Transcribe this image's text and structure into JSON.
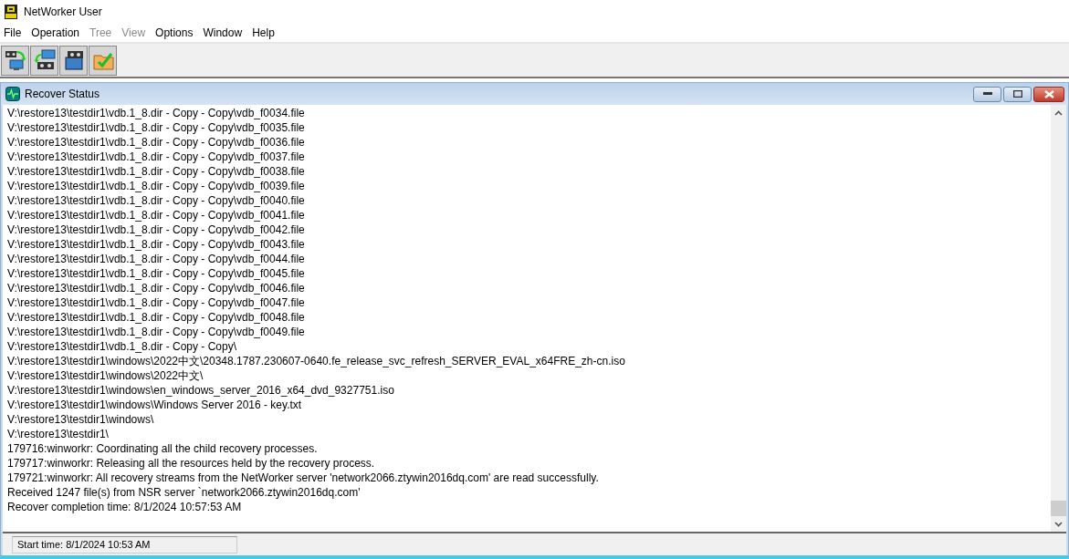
{
  "window": {
    "title": "NetWorker User"
  },
  "menu": [
    {
      "label": "File",
      "disabled": false
    },
    {
      "label": "Operation",
      "disabled": false
    },
    {
      "label": "Tree",
      "disabled": true
    },
    {
      "label": "View",
      "disabled": true
    },
    {
      "label": "Options",
      "disabled": false
    },
    {
      "label": "Window",
      "disabled": false
    },
    {
      "label": "Help",
      "disabled": false
    }
  ],
  "toolbar": [
    {
      "kind": "recover"
    },
    {
      "kind": "backup"
    },
    {
      "kind": "archive"
    },
    {
      "kind": "verify"
    }
  ],
  "child_window": {
    "title": "Recover Status"
  },
  "log_lines": [
    "V:\\restore13\\testdir1\\vdb.1_8.dir - Copy - Copy\\vdb_f0034.file",
    "V:\\restore13\\testdir1\\vdb.1_8.dir - Copy - Copy\\vdb_f0035.file",
    "V:\\restore13\\testdir1\\vdb.1_8.dir - Copy - Copy\\vdb_f0036.file",
    "V:\\restore13\\testdir1\\vdb.1_8.dir - Copy - Copy\\vdb_f0037.file",
    "V:\\restore13\\testdir1\\vdb.1_8.dir - Copy - Copy\\vdb_f0038.file",
    "V:\\restore13\\testdir1\\vdb.1_8.dir - Copy - Copy\\vdb_f0039.file",
    "V:\\restore13\\testdir1\\vdb.1_8.dir - Copy - Copy\\vdb_f0040.file",
    "V:\\restore13\\testdir1\\vdb.1_8.dir - Copy - Copy\\vdb_f0041.file",
    "V:\\restore13\\testdir1\\vdb.1_8.dir - Copy - Copy\\vdb_f0042.file",
    "V:\\restore13\\testdir1\\vdb.1_8.dir - Copy - Copy\\vdb_f0043.file",
    "V:\\restore13\\testdir1\\vdb.1_8.dir - Copy - Copy\\vdb_f0044.file",
    "V:\\restore13\\testdir1\\vdb.1_8.dir - Copy - Copy\\vdb_f0045.file",
    "V:\\restore13\\testdir1\\vdb.1_8.dir - Copy - Copy\\vdb_f0046.file",
    "V:\\restore13\\testdir1\\vdb.1_8.dir - Copy - Copy\\vdb_f0047.file",
    "V:\\restore13\\testdir1\\vdb.1_8.dir - Copy - Copy\\vdb_f0048.file",
    "V:\\restore13\\testdir1\\vdb.1_8.dir - Copy - Copy\\vdb_f0049.file",
    "V:\\restore13\\testdir1\\vdb.1_8.dir - Copy - Copy\\",
    "V:\\restore13\\testdir1\\windows\\2022中文\\20348.1787.230607-0640.fe_release_svc_refresh_SERVER_EVAL_x64FRE_zh-cn.iso",
    "V:\\restore13\\testdir1\\windows\\2022中文\\",
    "V:\\restore13\\testdir1\\windows\\en_windows_server_2016_x64_dvd_9327751.iso",
    "V:\\restore13\\testdir1\\windows\\Windows Server 2016 - key.txt",
    "V:\\restore13\\testdir1\\windows\\",
    "V:\\restore13\\testdir1\\",
    "179716:winworkr: Coordinating all the child recovery processes.",
    "179717:winworkr: Releasing all the resources held by the recovery process.",
    "179721:winworkr: All recovery streams from the NetWorker server 'network2066.ztywin2016dq.com' are read successfully.",
    "Received 1247 file(s) from NSR server `network2066.ztywin2016dq.com'",
    "Recover completion time: 8/1/2024 10:57:53 AM"
  ],
  "status_bar": {
    "start_time": "Start time: 8/1/2024 10:53 AM"
  }
}
